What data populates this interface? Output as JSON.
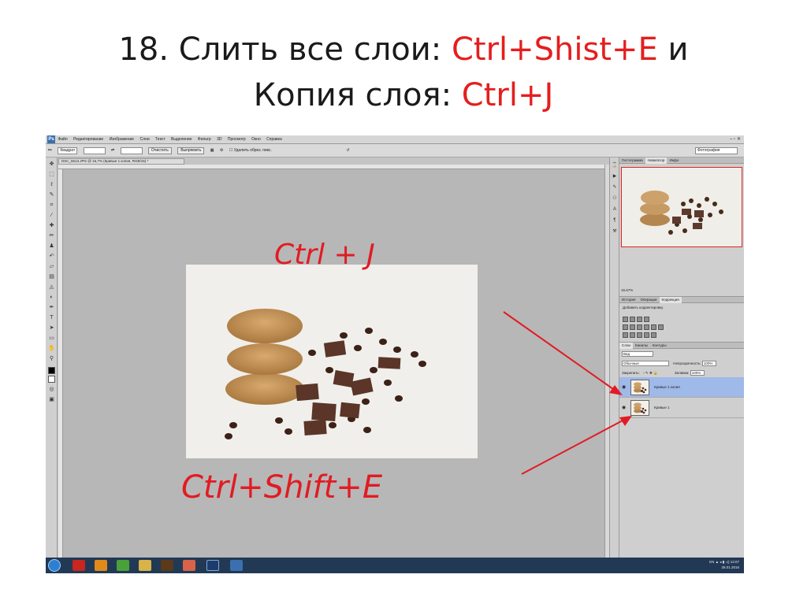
{
  "slide": {
    "title_line1_prefix": "18. Слить все слои: ",
    "title_line1_keys": "Ctrl+Shist+E",
    "title_line1_suffix": " и",
    "title_line2_prefix": "Копия слоя: ",
    "title_line2_keys": "Ctrl+J"
  },
  "photoshop": {
    "menu": [
      "Файл",
      "Редактирование",
      "Изображение",
      "Слои",
      "Текст",
      "Выделение",
      "Фильтр",
      "3D",
      "Просмотр",
      "Окно",
      "Справка"
    ],
    "options": {
      "field_1": "Квадрат",
      "clear_button": "Очистить",
      "straighten_button": "Выпрямить",
      "delete_pixels_label": "Удалить обрез. пикс."
    },
    "workspace": "Фотография",
    "document_tab": "DSC_5613.JPG @ 16,7% (Кривые 1 копия, RGB/16) *",
    "status": {
      "zoom": "16,67%",
      "doc": "Док: 80,0M/80,0M"
    },
    "navigator": {
      "tabs": [
        "Гистограмма",
        "Навигатор",
        "Инфо"
      ],
      "active_tab": "Навигатор",
      "zoom": "16.67%"
    },
    "corrections": {
      "tabs": [
        "История",
        "Операции",
        "Коррекция"
      ],
      "label": "Добавить корректировку"
    },
    "layers_panel": {
      "tabs": [
        "Слои",
        "Каналы",
        "Контуры"
      ],
      "kind": "Вид",
      "mode": "Обычные",
      "opacity_label": "Непрозрачность:",
      "opacity_value": "100%",
      "lock_label": "Закрепить:",
      "fill_label": "Заливка:",
      "fill_value": "100%",
      "layers": [
        {
          "name": "Кривые 1 копия",
          "selected": true
        },
        {
          "name": "Кривые 1",
          "selected": false
        }
      ]
    },
    "annotations": {
      "top_note": "Ctrl + J",
      "bottom_note": "Ctrl+Shift+E",
      "color": "#e21b23"
    },
    "taskbar": {
      "lang": "EN",
      "time": "12:07",
      "date": "26.01.2016"
    }
  }
}
